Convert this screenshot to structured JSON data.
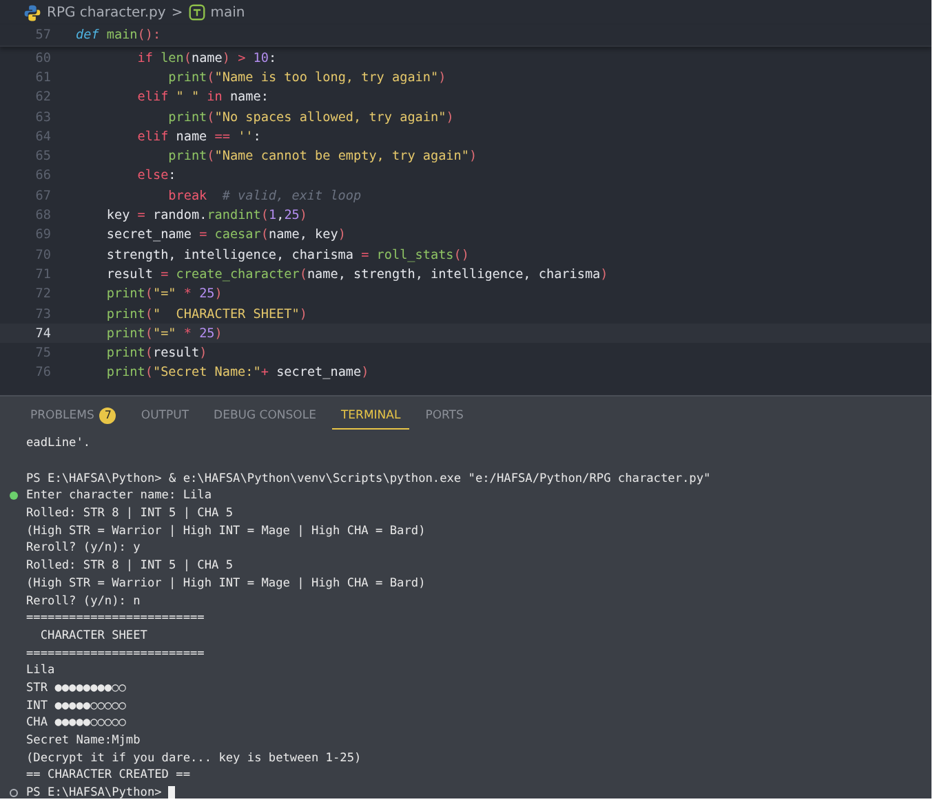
{
  "breadcrumb": {
    "file": "RPG character.py",
    "separator": ">",
    "symbol": "main"
  },
  "editor": {
    "sticky_line": {
      "number": "57",
      "tokens": [
        {
          "text": "def ",
          "kind": "def"
        },
        {
          "text": "main",
          "kind": "fn"
        },
        {
          "text": "():",
          "kind": "punct"
        }
      ]
    },
    "lines": [
      {
        "number": "60",
        "current": false,
        "tokens": [
          {
            "text": "        if",
            "kind": "kw"
          },
          {
            "text": " len",
            "kind": "fn"
          },
          {
            "text": "(",
            "kind": "punct"
          },
          {
            "text": "name",
            "kind": "var"
          },
          {
            "text": ")",
            "kind": "punct"
          },
          {
            "text": " > ",
            "kind": "op"
          },
          {
            "text": "10",
            "kind": "num"
          },
          {
            "text": ":",
            "kind": "var"
          }
        ]
      },
      {
        "number": "61",
        "current": false,
        "tokens": [
          {
            "text": "            print",
            "kind": "fn"
          },
          {
            "text": "(",
            "kind": "punct"
          },
          {
            "text": "\"Name is too long, try again\"",
            "kind": "str"
          },
          {
            "text": ")",
            "kind": "punct"
          }
        ]
      },
      {
        "number": "62",
        "current": false,
        "tokens": [
          {
            "text": "        elif",
            "kind": "kw"
          },
          {
            "text": " \" \"",
            "kind": "str"
          },
          {
            "text": " in",
            "kind": "kw"
          },
          {
            "text": " name",
            "kind": "var"
          },
          {
            "text": ":",
            "kind": "var"
          }
        ]
      },
      {
        "number": "63",
        "current": false,
        "tokens": [
          {
            "text": "            print",
            "kind": "fn"
          },
          {
            "text": "(",
            "kind": "punct"
          },
          {
            "text": "\"No spaces allowed, try again\"",
            "kind": "str"
          },
          {
            "text": ")",
            "kind": "punct"
          }
        ]
      },
      {
        "number": "64",
        "current": false,
        "tokens": [
          {
            "text": "        elif",
            "kind": "kw"
          },
          {
            "text": " name",
            "kind": "var"
          },
          {
            "text": " == ",
            "kind": "op"
          },
          {
            "text": "''",
            "kind": "str"
          },
          {
            "text": ":",
            "kind": "var"
          }
        ]
      },
      {
        "number": "65",
        "current": false,
        "tokens": [
          {
            "text": "            print",
            "kind": "fn"
          },
          {
            "text": "(",
            "kind": "punct"
          },
          {
            "text": "\"Name cannot be empty, try again\"",
            "kind": "str"
          },
          {
            "text": ")",
            "kind": "punct"
          }
        ]
      },
      {
        "number": "66",
        "current": false,
        "tokens": [
          {
            "text": "        else",
            "kind": "kw"
          },
          {
            "text": ":",
            "kind": "var"
          }
        ]
      },
      {
        "number": "67",
        "current": false,
        "tokens": [
          {
            "text": "            break",
            "kind": "kw"
          },
          {
            "text": "  # valid, exit loop",
            "kind": "comment"
          }
        ]
      },
      {
        "number": "68",
        "current": false,
        "tokens": [
          {
            "text": "    key",
            "kind": "var"
          },
          {
            "text": " = ",
            "kind": "op"
          },
          {
            "text": "random",
            "kind": "var"
          },
          {
            "text": ".",
            "kind": "var"
          },
          {
            "text": "randint",
            "kind": "fn"
          },
          {
            "text": "(",
            "kind": "punct"
          },
          {
            "text": "1",
            "kind": "num"
          },
          {
            "text": ",",
            "kind": "var"
          },
          {
            "text": "25",
            "kind": "num"
          },
          {
            "text": ")",
            "kind": "punct"
          }
        ]
      },
      {
        "number": "69",
        "current": false,
        "tokens": [
          {
            "text": "    secret_name",
            "kind": "var"
          },
          {
            "text": " = ",
            "kind": "op"
          },
          {
            "text": "caesar",
            "kind": "fn"
          },
          {
            "text": "(",
            "kind": "punct"
          },
          {
            "text": "name, key",
            "kind": "var"
          },
          {
            "text": ")",
            "kind": "punct"
          }
        ]
      },
      {
        "number": "70",
        "current": false,
        "tokens": [
          {
            "text": "    strength, intelligence, charisma",
            "kind": "var"
          },
          {
            "text": " = ",
            "kind": "op"
          },
          {
            "text": "roll_stats",
            "kind": "fn"
          },
          {
            "text": "()",
            "kind": "punct"
          }
        ]
      },
      {
        "number": "71",
        "current": false,
        "tokens": [
          {
            "text": "    result",
            "kind": "var"
          },
          {
            "text": " = ",
            "kind": "op"
          },
          {
            "text": "create_character",
            "kind": "fn"
          },
          {
            "text": "(",
            "kind": "punct"
          },
          {
            "text": "name, strength, intelligence, charisma",
            "kind": "var"
          },
          {
            "text": ")",
            "kind": "punct"
          }
        ]
      },
      {
        "number": "72",
        "current": false,
        "tokens": [
          {
            "text": "    print",
            "kind": "fn"
          },
          {
            "text": "(",
            "kind": "punct"
          },
          {
            "text": "\"=\"",
            "kind": "str"
          },
          {
            "text": " * ",
            "kind": "op"
          },
          {
            "text": "25",
            "kind": "num"
          },
          {
            "text": ")",
            "kind": "punct"
          }
        ]
      },
      {
        "number": "73",
        "current": false,
        "tokens": [
          {
            "text": "    print",
            "kind": "fn"
          },
          {
            "text": "(",
            "kind": "punct"
          },
          {
            "text": "\"  CHARACTER SHEET\"",
            "kind": "str"
          },
          {
            "text": ")",
            "kind": "punct"
          }
        ]
      },
      {
        "number": "74",
        "current": true,
        "tokens": [
          {
            "text": "    print",
            "kind": "fn"
          },
          {
            "text": "(",
            "kind": "punct"
          },
          {
            "text": "\"=\"",
            "kind": "str"
          },
          {
            "text": " * ",
            "kind": "op"
          },
          {
            "text": "25",
            "kind": "num"
          },
          {
            "text": ")",
            "kind": "punct"
          }
        ]
      },
      {
        "number": "75",
        "current": false,
        "tokens": [
          {
            "text": "    print",
            "kind": "fn"
          },
          {
            "text": "(",
            "kind": "punct"
          },
          {
            "text": "result",
            "kind": "var"
          },
          {
            "text": ")",
            "kind": "punct"
          }
        ]
      },
      {
        "number": "76",
        "current": false,
        "tokens": [
          {
            "text": "    print",
            "kind": "fn"
          },
          {
            "text": "(",
            "kind": "punct"
          },
          {
            "text": "\"Secret Name:\"",
            "kind": "str"
          },
          {
            "text": "+ ",
            "kind": "op"
          },
          {
            "text": "secret_name",
            "kind": "var"
          },
          {
            "text": ")",
            "kind": "punct"
          }
        ]
      }
    ]
  },
  "panel": {
    "tabs": [
      {
        "label": "PROBLEMS",
        "badge": "7",
        "selected": false
      },
      {
        "label": "OUTPUT",
        "selected": false
      },
      {
        "label": "DEBUG CONSOLE",
        "selected": false
      },
      {
        "label": "TERMINAL",
        "selected": true
      },
      {
        "label": "PORTS",
        "selected": false
      }
    ],
    "terminal": [
      {
        "text": "eadLine'.",
        "dot": false,
        "cursor": false
      },
      {
        "dot": false,
        "cursor": false
      },
      {
        "text": "PS E:\\HAFSA\\Python> & e:\\HAFSA\\Python\\venv\\Scripts\\python.exe \"e:/HAFSA/Python/RPG character.py\"",
        "dot": false,
        "cursor": false
      },
      {
        "text": "Enter character name: Lila",
        "dot": true,
        "filled": true,
        "cursor": false
      },
      {
        "text": "Rolled: STR 8 | INT 5 | CHA 5",
        "dot": false,
        "cursor": false
      },
      {
        "text": "(High STR = Warrior | High INT = Mage | High CHA = Bard)",
        "dot": false,
        "cursor": false
      },
      {
        "text": "Reroll? (y/n): y",
        "dot": false,
        "cursor": false
      },
      {
        "text": "Rolled: STR 8 | INT 5 | CHA 5",
        "dot": false,
        "cursor": false
      },
      {
        "text": "(High STR = Warrior | High INT = Mage | High CHA = Bard)",
        "dot": false,
        "cursor": false
      },
      {
        "text": "Reroll? (y/n): n",
        "dot": false,
        "cursor": false
      },
      {
        "text": "=========================",
        "dot": false,
        "cursor": false
      },
      {
        "text": "  CHARACTER SHEET",
        "dot": false,
        "cursor": false
      },
      {
        "text": "=========================",
        "dot": false,
        "cursor": false
      },
      {
        "text": "Lila",
        "dot": false,
        "cursor": false
      },
      {
        "text": "STR ●●●●●●●●○○",
        "dot": false,
        "cursor": false
      },
      {
        "text": "INT ●●●●●○○○○○",
        "dot": false,
        "cursor": false
      },
      {
        "text": "CHA ●●●●●○○○○○",
        "dot": false,
        "cursor": false
      },
      {
        "text": "Secret Name:Mjmb",
        "dot": false,
        "cursor": false
      },
      {
        "text": "(Decrypt it if you dare... key is between 1-25)",
        "dot": false,
        "cursor": false
      },
      {
        "text": "== CHARACTER CREATED ==",
        "dot": false,
        "cursor": false
      },
      {
        "text": "PS E:\\HAFSA\\Python>",
        "dot": true,
        "filled": false,
        "cursor": true
      }
    ]
  }
}
